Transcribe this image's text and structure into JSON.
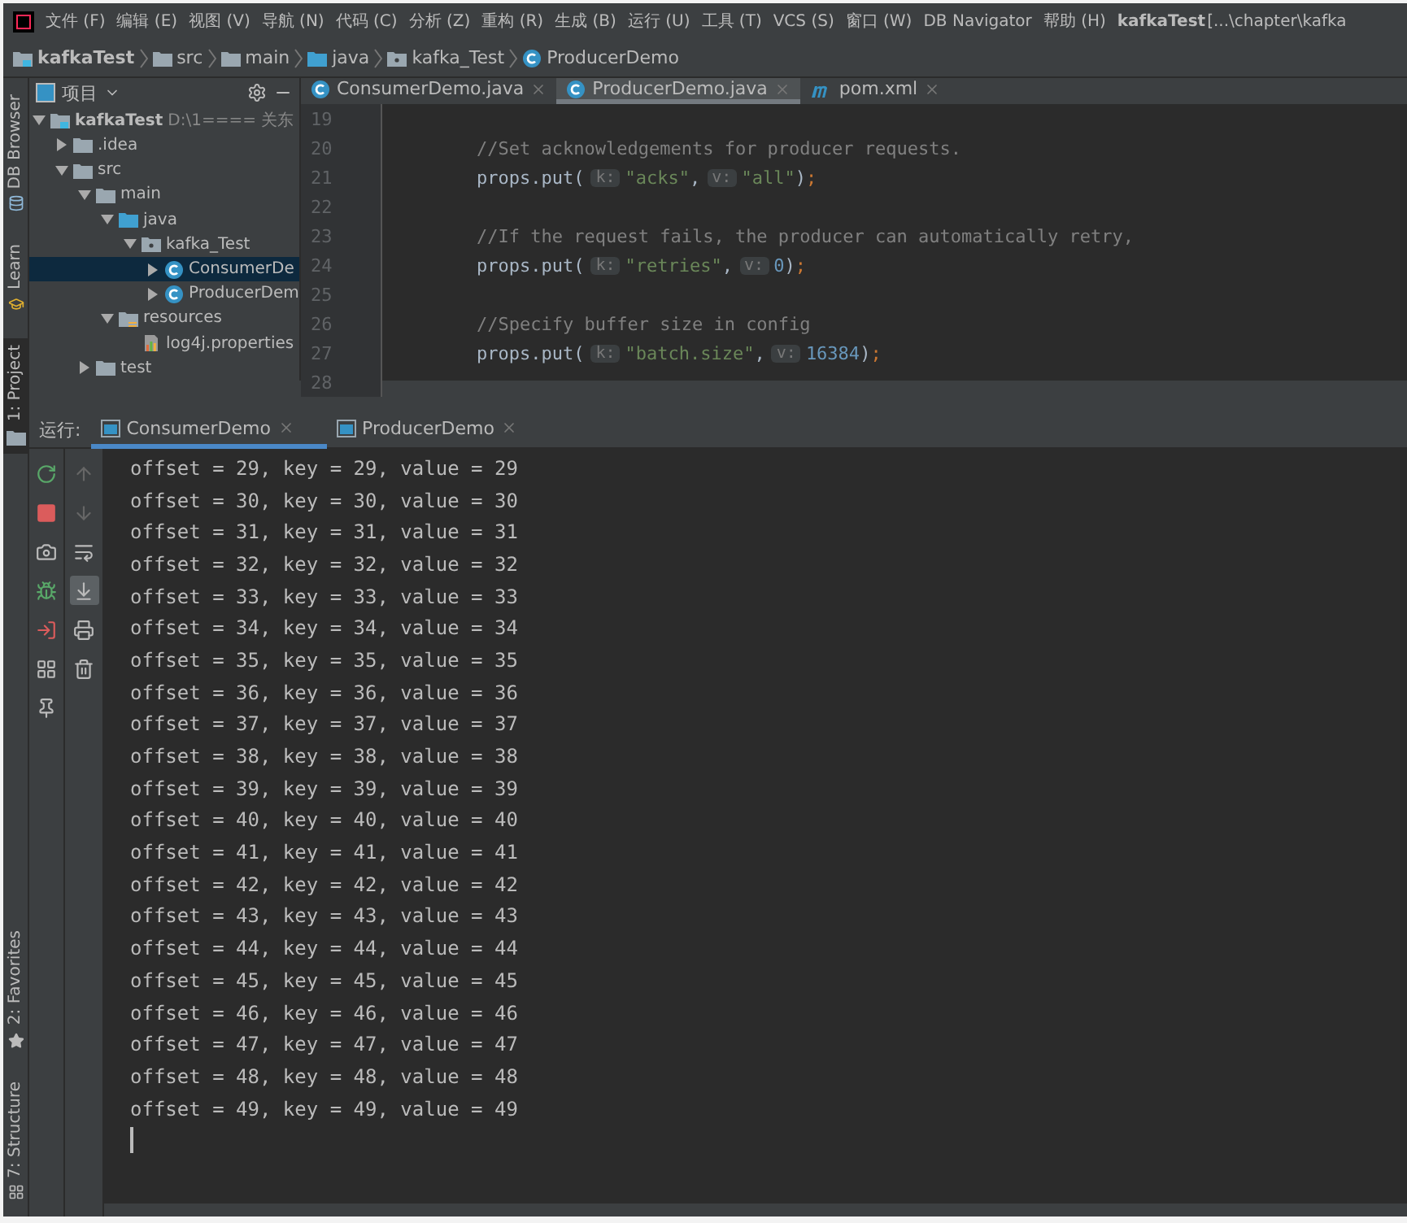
{
  "menu_bar": {
    "items": [
      "文件 (F)",
      "编辑 (E)",
      "视图 (V)",
      "导航 (N)",
      "代码 (C)",
      "分析 (Z)",
      "重构 (R)",
      "生成 (B)",
      "运行 (U)",
      "工具 (T)",
      "VCS (S)",
      "窗口 (W)",
      "DB Navigator",
      "帮助 (H)"
    ],
    "project_name": "kafkaTest",
    "path": "[...\\chapter\\kafka"
  },
  "breadcrumb": [
    {
      "label": "kafkaTest",
      "kind": "project"
    },
    {
      "label": "src",
      "kind": "folder"
    },
    {
      "label": "main",
      "kind": "folder"
    },
    {
      "label": "java",
      "kind": "source"
    },
    {
      "label": "kafka_Test",
      "kind": "package"
    },
    {
      "label": "ProducerDemo",
      "kind": "class"
    }
  ],
  "side_tabs": [
    {
      "label": "DB Browser",
      "kind": "db",
      "selected": false
    },
    {
      "label": "Learn",
      "kind": "learn",
      "selected": false
    },
    {
      "label": "1: Project",
      "kind": "folder",
      "selected": true
    }
  ],
  "side_tabs_bottom": [
    {
      "label": "2: Favorites",
      "kind": "star",
      "selected": false
    },
    {
      "label": "7: Structure",
      "kind": "structure",
      "selected": false
    }
  ],
  "project_panel": {
    "title": "项目",
    "tree": [
      {
        "label": "kafkaTest",
        "detail": "D:\\1==== 关东",
        "kind": "project",
        "expanded": true,
        "selected": false,
        "children": [
          {
            "label": ".idea",
            "kind": "folder",
            "expanded": false,
            "selected": false
          },
          {
            "label": "src",
            "kind": "folder",
            "expanded": true,
            "selected": false,
            "children": [
              {
                "label": "main",
                "kind": "folder",
                "expanded": true,
                "selected": false,
                "children": [
                  {
                    "label": "java",
                    "kind": "source",
                    "expanded": true,
                    "selected": false,
                    "children": [
                      {
                        "label": "kafka_Test",
                        "kind": "package",
                        "expanded": true,
                        "selected": false,
                        "children": [
                          {
                            "label": "ConsumerDe",
                            "kind": "class",
                            "expanded": false,
                            "selected": true
                          },
                          {
                            "label": "ProducerDem",
                            "kind": "class",
                            "expanded": false,
                            "selected": false
                          }
                        ]
                      }
                    ]
                  },
                  {
                    "label": "resources",
                    "kind": "resources",
                    "expanded": true,
                    "selected": false,
                    "children": [
                      {
                        "label": "log4j.properties",
                        "kind": "properties",
                        "selected": false
                      }
                    ]
                  }
                ]
              },
              {
                "label": "test",
                "kind": "folder",
                "expanded": false,
                "selected": false
              }
            ]
          }
        ]
      }
    ]
  },
  "editor": {
    "tabs": [
      {
        "label": "ConsumerDemo.java",
        "kind": "class",
        "selected": false
      },
      {
        "label": "ProducerDemo.java",
        "kind": "class",
        "selected": true
      },
      {
        "label": "pom.xml",
        "kind": "maven",
        "selected": false
      }
    ],
    "lines": [
      {
        "number": "19"
      },
      {
        "number": "20",
        "segments": [
          {
            "kind": "comment",
            "text": "//Set acknowledgements for producer requests."
          }
        ]
      },
      {
        "number": "21",
        "segments": [
          {
            "kind": "plain",
            "text": "props.put("
          },
          {
            "kind": "hint",
            "text": "k:"
          },
          {
            "kind": "string",
            "text": "\"acks\""
          },
          {
            "kind": "plain",
            "text": ","
          },
          {
            "kind": "hint",
            "text": "v:"
          },
          {
            "kind": "string",
            "text": "\"all\""
          },
          {
            "kind": "plain",
            "text": ")"
          },
          {
            "kind": "punct",
            "text": ";"
          }
        ]
      },
      {
        "number": "22"
      },
      {
        "number": "23",
        "segments": [
          {
            "kind": "comment",
            "text": "//If the request fails, the producer can automatically retry,"
          }
        ]
      },
      {
        "number": "24",
        "segments": [
          {
            "kind": "plain",
            "text": "props.put("
          },
          {
            "kind": "hint",
            "text": "k:"
          },
          {
            "kind": "string",
            "text": "\"retries\""
          },
          {
            "kind": "plain",
            "text": ","
          },
          {
            "kind": "hint",
            "text": "v:"
          },
          {
            "kind": "number",
            "text": "0"
          },
          {
            "kind": "plain",
            "text": ")"
          },
          {
            "kind": "punct",
            "text": ";"
          }
        ]
      },
      {
        "number": "25"
      },
      {
        "number": "26",
        "segments": [
          {
            "kind": "comment",
            "text": "//Specify buffer size in config"
          }
        ]
      },
      {
        "number": "27",
        "segments": [
          {
            "kind": "plain",
            "text": "props.put("
          },
          {
            "kind": "hint",
            "text": "k:"
          },
          {
            "kind": "string",
            "text": "\"batch.size\""
          },
          {
            "kind": "plain",
            "text": ","
          },
          {
            "kind": "hint",
            "text": "v:"
          },
          {
            "kind": "number",
            "text": "16384"
          },
          {
            "kind": "plain",
            "text": ")"
          },
          {
            "kind": "punct",
            "text": ";"
          }
        ]
      },
      {
        "number": "28"
      }
    ]
  },
  "run_panel": {
    "label": "运行:",
    "tabs": [
      {
        "label": "ConsumerDemo",
        "selected": true
      },
      {
        "label": "ProducerDemo",
        "selected": false
      }
    ],
    "tools": [
      {
        "kind": "rerun",
        "selected": false
      },
      {
        "kind": "stop",
        "selected": false
      },
      {
        "kind": "camera",
        "selected": false
      },
      {
        "kind": "bug",
        "selected": false
      },
      {
        "kind": "exit",
        "selected": false
      },
      {
        "kind": "layout",
        "selected": false
      },
      {
        "kind": "pin",
        "selected": false
      }
    ],
    "tools_2": [
      {
        "kind": "up",
        "selected": false
      },
      {
        "kind": "down",
        "selected": false
      },
      {
        "kind": "wrap",
        "selected": false
      },
      {
        "kind": "scroll",
        "selected": true
      },
      {
        "kind": "print",
        "selected": false
      },
      {
        "kind": "trash",
        "selected": false
      }
    ],
    "output": [
      "offset = 29, key = 29, value = 29",
      "offset = 30, key = 30, value = 30",
      "offset = 31, key = 31, value = 31",
      "offset = 32, key = 32, value = 32",
      "offset = 33, key = 33, value = 33",
      "offset = 34, key = 34, value = 34",
      "offset = 35, key = 35, value = 35",
      "offset = 36, key = 36, value = 36",
      "offset = 37, key = 37, value = 37",
      "offset = 38, key = 38, value = 38",
      "offset = 39, key = 39, value = 39",
      "offset = 40, key = 40, value = 40",
      "offset = 41, key = 41, value = 41",
      "offset = 42, key = 42, value = 42",
      "offset = 43, key = 43, value = 43",
      "offset = 44, key = 44, value = 44",
      "offset = 45, key = 45, value = 45",
      "offset = 46, key = 46, value = 46",
      "offset = 47, key = 47, value = 47",
      "offset = 48, key = 48, value = 48",
      "offset = 49, key = 49, value = 49"
    ]
  }
}
